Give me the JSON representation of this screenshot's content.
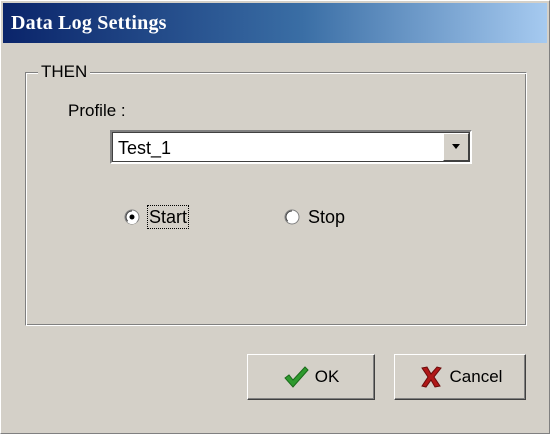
{
  "window": {
    "title": "Data Log Settings"
  },
  "group": {
    "legend": "THEN"
  },
  "profile": {
    "label": "Profile :",
    "selected": "Test_1"
  },
  "action": {
    "options": [
      {
        "label": "Start",
        "checked": true
      },
      {
        "label": "Stop",
        "checked": false
      }
    ]
  },
  "buttons": {
    "ok_label": "OK",
    "cancel_label": "Cancel"
  },
  "icons": {
    "dropdown": "chevron-down-icon",
    "ok": "checkmark-icon",
    "cancel": "close-icon"
  },
  "colors": {
    "titlebar_start": "#0a246a",
    "titlebar_end": "#a6caf0",
    "dialog_bg": "#d4d0c8",
    "ok_icon": "#2e9a2e",
    "cancel_icon": "#b01818"
  }
}
